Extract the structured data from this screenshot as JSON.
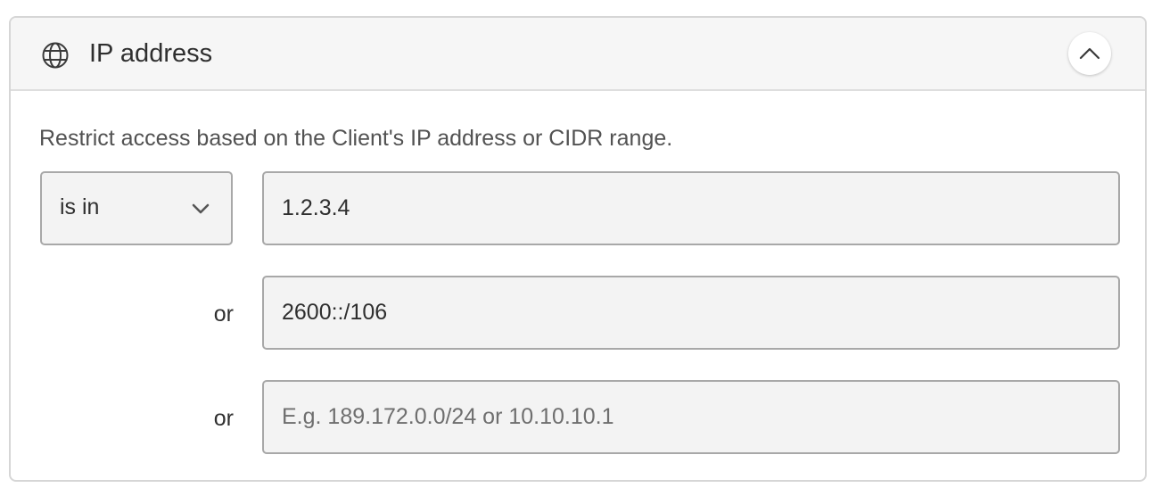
{
  "header": {
    "icon": "globe-icon",
    "title": "IP address",
    "collapse_icon": "chevron-up-icon"
  },
  "description": "Restrict access based on the Client's IP address or CIDR range.",
  "operator": {
    "selected": "is in",
    "icon": "chevron-down-icon"
  },
  "entries": [
    {
      "value": "1.2.3.4",
      "placeholder": ""
    },
    {
      "value": "2600::/106",
      "placeholder": ""
    },
    {
      "value": "",
      "placeholder": "E.g. 189.172.0.0/24 or 10.10.10.1"
    }
  ],
  "or_labels": [
    "or",
    "or"
  ]
}
